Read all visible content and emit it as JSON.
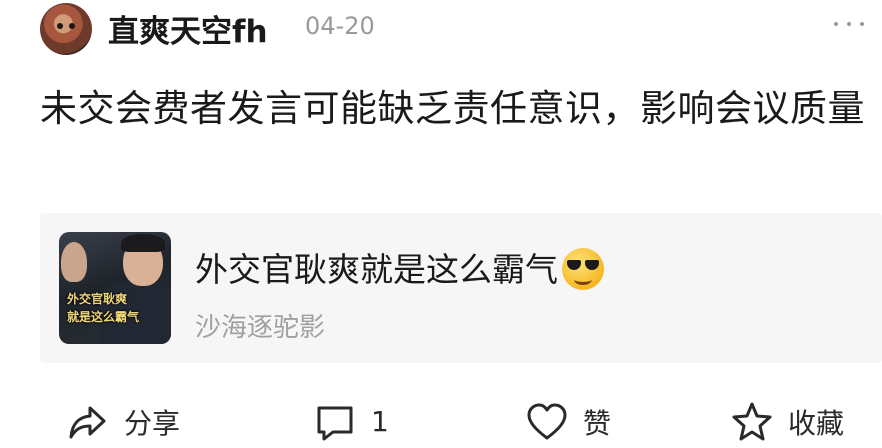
{
  "post": {
    "username": "直爽天空fh",
    "date": "04-20",
    "content": "未交会费者发言可能缺乏责任意识，影响会议质量"
  },
  "share_card": {
    "title": "外交官耿爽就是这么霸气",
    "subtitle": "沙海逐驼影",
    "thumbnail_caption_line1": "外交官耿爽",
    "thumbnail_caption_line2": "就是这么霸气"
  },
  "actions": {
    "share_label": "分享",
    "comment_count": "1",
    "like_label": "赞",
    "favorite_label": "收藏"
  },
  "icons": {
    "share": "share-arrow-icon",
    "comment": "comment-bubble-icon",
    "like": "heart-icon",
    "favorite": "star-icon",
    "more": "more-dots-icon",
    "emoji": "sunglasses-emoji-icon"
  }
}
